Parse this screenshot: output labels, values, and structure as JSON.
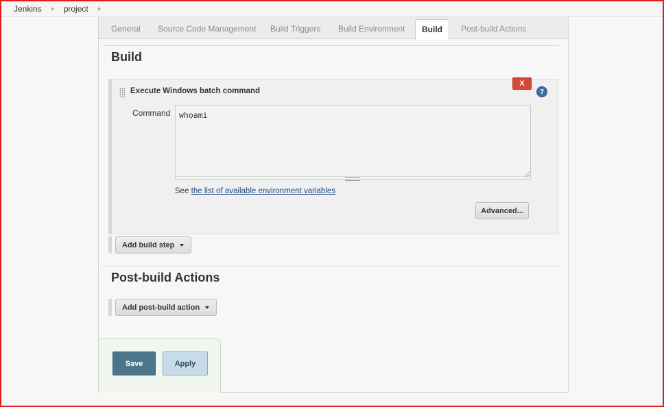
{
  "breadcrumb": {
    "items": [
      "Jenkins",
      "project"
    ]
  },
  "tabs": [
    {
      "label": "General"
    },
    {
      "label": "Source Code Management"
    },
    {
      "label": "Build Triggers"
    },
    {
      "label": "Build Environment"
    },
    {
      "label": "Build",
      "active": true
    },
    {
      "label": "Post-build Actions"
    }
  ],
  "build": {
    "title": "Build",
    "step": {
      "title": "Execute Windows batch command",
      "delete_label": "X",
      "help_label": "?",
      "command_label": "Command",
      "command_value": "whoami",
      "env_prefix": "See",
      "env_link": "the list of available environment variables",
      "advanced_label": "Advanced..."
    },
    "add_step_label": "Add build step"
  },
  "post_build": {
    "title": "Post-build Actions",
    "add_action_label": "Add post-build action"
  },
  "footer": {
    "save_label": "Save",
    "apply_label": "Apply"
  },
  "colors": {
    "frame_border": "#e11d1d",
    "save_button": "#4b758b",
    "apply_button": "#c7dbe8",
    "delete_button": "#d24939",
    "link": "#204a87"
  }
}
